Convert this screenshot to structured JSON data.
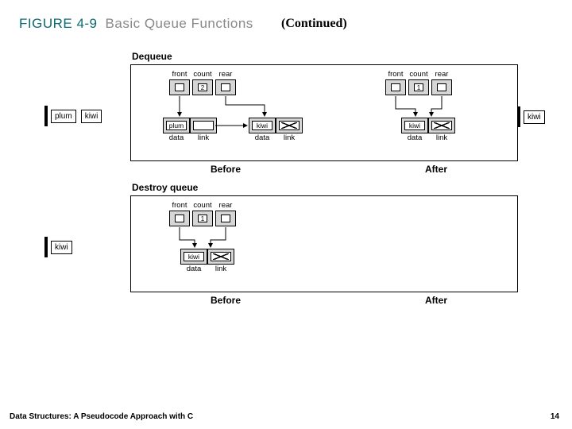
{
  "figure": {
    "label": "FIGURE 4-9",
    "title": "Basic Queue Functions",
    "continued": "(Continued)"
  },
  "sections": {
    "dequeue": {
      "label": "Dequeue",
      "before_label": "Before",
      "after_label": "After",
      "left_callouts": [
        "plum",
        "kiwi"
      ],
      "right_callout": "kiwi",
      "before": {
        "header": {
          "front": "front",
          "count": "count",
          "rear": "rear",
          "count_value": "2"
        },
        "nodes": [
          {
            "data_label": "data",
            "link_label": "link",
            "data_value": "plum",
            "link_null": false
          },
          {
            "data_label": "data",
            "link_label": "link",
            "data_value": "kiwi",
            "link_null": true
          }
        ]
      },
      "after": {
        "header": {
          "front": "front",
          "count": "count",
          "rear": "rear",
          "count_value": "1"
        },
        "nodes": [
          {
            "data_label": "data",
            "link_label": "link",
            "data_value": "kiwi",
            "link_null": true
          }
        ]
      }
    },
    "destroy": {
      "label": "Destroy queue",
      "before_label": "Before",
      "after_label": "After",
      "left_callouts": [
        "kiwi"
      ],
      "before": {
        "header": {
          "front": "front",
          "count": "count",
          "rear": "rear",
          "count_value": "1"
        },
        "nodes": [
          {
            "data_label": "data",
            "link_label": "link",
            "data_value": "kiwi",
            "link_null": true
          }
        ]
      },
      "after": {}
    }
  },
  "footer": {
    "text": "Data Structures: A Pseudocode Approach with C",
    "page": "14"
  }
}
